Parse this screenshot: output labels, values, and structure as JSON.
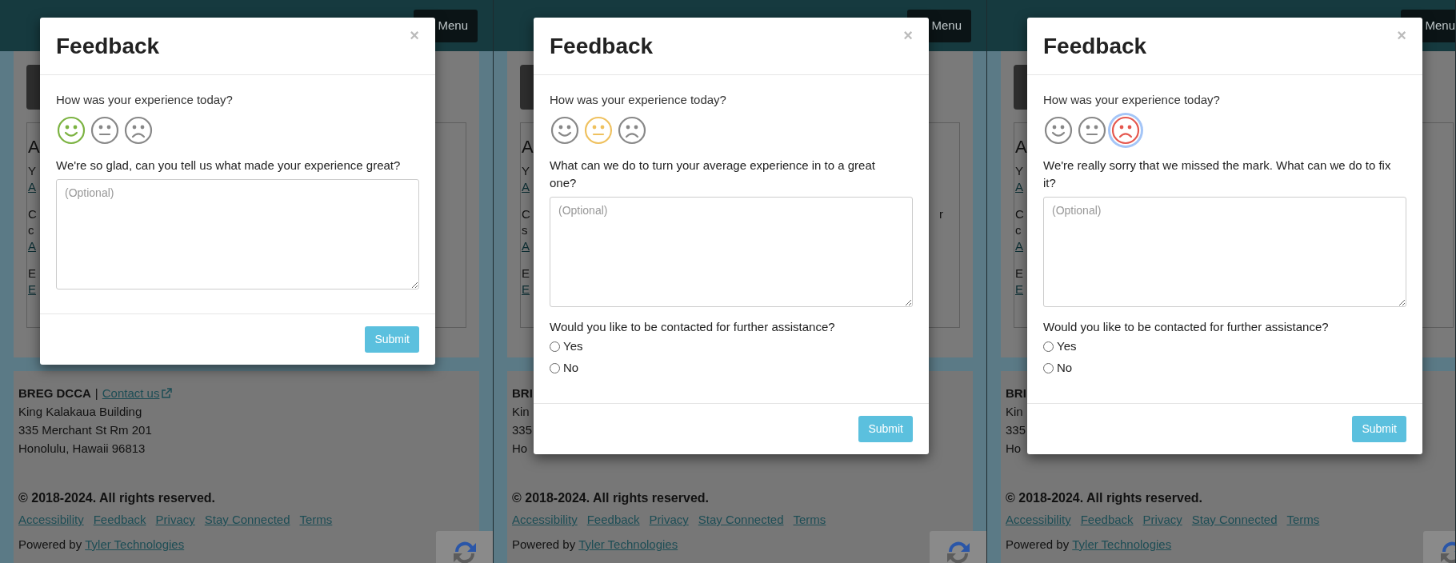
{
  "panels": [
    {
      "menu_button": "Menu",
      "card": {
        "heading": "A",
        "paragraphs": [
          [
            {
              "text": "Y",
              "kind": "text"
            },
            {
              "text": "A",
              "kind": "link"
            }
          ],
          [
            {
              "text": "C",
              "kind": "text"
            },
            {
              "text": "c",
              "kind": "text"
            },
            {
              "text": "A",
              "kind": "link"
            }
          ],
          [
            {
              "text": "E",
              "kind": "text"
            },
            {
              "text": "E",
              "kind": "link"
            }
          ]
        ]
      },
      "footer": {
        "org": "BREG DCCA",
        "separator": "|",
        "contact_link": "Contact us",
        "address": [
          "King Kalakaua Building",
          "335 Merchant St Rm 201",
          "Honolulu, Hawaii 96813"
        ],
        "copyright": "© 2018-2024. All rights reserved.",
        "links": [
          "Accessibility",
          "Feedback",
          "Privacy",
          "Stay Connected",
          "Terms"
        ],
        "powered_prefix": "Powered by",
        "powered_link": "Tyler Technologies"
      },
      "modal": {
        "title": "Feedback",
        "close": "×",
        "question": "How was your experience today?",
        "faces": [
          {
            "kind": "happy",
            "selected": true,
            "focused": false
          },
          {
            "kind": "neutral",
            "selected": false,
            "focused": false
          },
          {
            "kind": "sad",
            "selected": false,
            "focused": false
          }
        ],
        "prompt": "We're so glad, can you tell us what made your experience great?",
        "placeholder": "(Optional)",
        "submit": "Submit"
      }
    },
    {
      "menu_button": "Menu",
      "card": {
        "heading": "A",
        "paragraphs": [
          [
            {
              "text": "Y",
              "kind": "text"
            },
            {
              "text": "A",
              "kind": "link"
            }
          ],
          [
            {
              "text": "C",
              "kind": "text",
              "right": "r"
            },
            {
              "text": "s",
              "kind": "text"
            },
            {
              "text": "A",
              "kind": "link"
            }
          ],
          [
            {
              "text": "E",
              "kind": "text"
            },
            {
              "text": "E",
              "kind": "link"
            }
          ]
        ]
      },
      "footer": {
        "org": "BRI",
        "address": [
          "Kin",
          "335",
          "Ho"
        ],
        "copyright": "© 2018-2024. All rights reserved.",
        "links": [
          "Accessibility",
          "Feedback",
          "Privacy",
          "Stay Connected",
          "Terms"
        ],
        "powered_prefix": "Powered by",
        "powered_link": "Tyler Technologies"
      },
      "modal": {
        "title": "Feedback",
        "close": "×",
        "question": "How was your experience today?",
        "faces": [
          {
            "kind": "happy",
            "selected": false,
            "focused": false
          },
          {
            "kind": "neutral",
            "selected": true,
            "focused": false
          },
          {
            "kind": "sad",
            "selected": false,
            "focused": false
          }
        ],
        "prompt": "What can we do to turn your average experience in to a great one?",
        "placeholder": "(Optional)",
        "contact_question": "Would you like to be contacted for further assistance?",
        "options": [
          {
            "label": "Yes",
            "selected": false
          },
          {
            "label": "No",
            "selected": false
          }
        ],
        "submit": "Submit"
      }
    },
    {
      "menu_button": "Menu",
      "card": {
        "heading": "A",
        "paragraphs": [
          [
            {
              "text": "Y",
              "kind": "text"
            },
            {
              "text": "A",
              "kind": "link"
            }
          ],
          [
            {
              "text": "C",
              "kind": "text"
            },
            {
              "text": "c",
              "kind": "text"
            },
            {
              "text": "A",
              "kind": "link"
            }
          ],
          [
            {
              "text": "E",
              "kind": "text"
            },
            {
              "text": "E",
              "kind": "link"
            }
          ]
        ]
      },
      "footer": {
        "org": "BRI",
        "address": [
          "Kin",
          "335",
          "Ho"
        ],
        "copyright": "© 2018-2024. All rights reserved.",
        "links": [
          "Accessibility",
          "Feedback",
          "Privacy",
          "Stay Connected",
          "Terms"
        ],
        "powered_prefix": "Powered by",
        "powered_link": "Tyler Technologies"
      },
      "modal": {
        "title": "Feedback",
        "close": "×",
        "question": "How was your experience today?",
        "faces": [
          {
            "kind": "happy",
            "selected": false,
            "focused": false
          },
          {
            "kind": "neutral",
            "selected": false,
            "focused": false
          },
          {
            "kind": "sad",
            "selected": true,
            "focused": true
          }
        ],
        "prompt": "We're really sorry that we missed the mark. What can we do to fix it?",
        "placeholder": "(Optional)",
        "contact_question": "Would you like to be contacted for further assistance?",
        "options": [
          {
            "label": "Yes",
            "selected": false
          },
          {
            "label": "No",
            "selected": false
          }
        ],
        "submit": "Submit"
      }
    }
  ]
}
